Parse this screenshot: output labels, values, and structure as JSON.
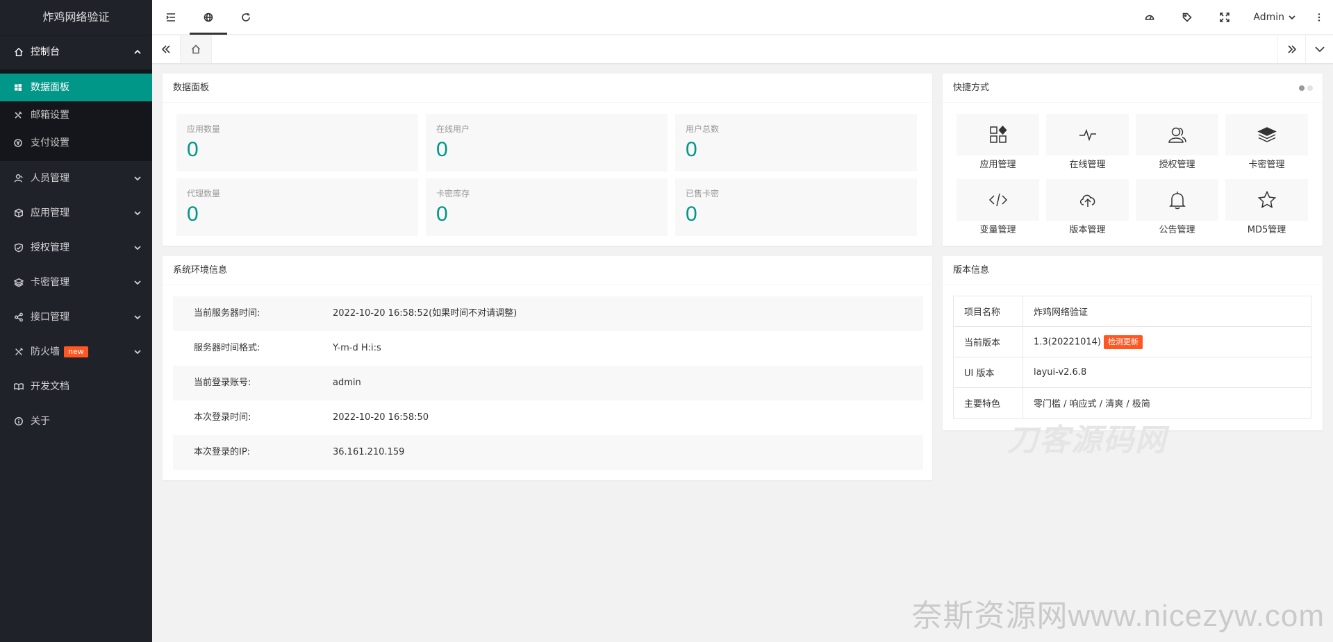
{
  "sidebar": {
    "logo": "炸鸡网络验证",
    "groups": [
      {
        "label": "控制台",
        "icon": "home-icon",
        "expanded": true,
        "children": [
          {
            "label": "数据面板",
            "icon": "windows-icon",
            "active": true
          },
          {
            "label": "邮箱设置",
            "icon": "tools-icon"
          },
          {
            "label": "支付设置",
            "icon": "yen-icon"
          }
        ]
      },
      {
        "label": "人员管理",
        "icon": "user-icon"
      },
      {
        "label": "应用管理",
        "icon": "cube-icon"
      },
      {
        "label": "授权管理",
        "icon": "shield-icon"
      },
      {
        "label": "卡密管理",
        "icon": "layers-icon"
      },
      {
        "label": "接口管理",
        "icon": "share-icon"
      },
      {
        "label": "防火墙",
        "icon": "tools-icon",
        "badge": "new"
      },
      {
        "label": "开发文档",
        "icon": "read-icon"
      },
      {
        "label": "关于",
        "icon": "info-icon"
      }
    ]
  },
  "header": {
    "user": "Admin"
  },
  "data_panel": {
    "title": "数据面板",
    "stats": [
      {
        "label": "应用数量",
        "value": "0"
      },
      {
        "label": "在线用户",
        "value": "0"
      },
      {
        "label": "用户总数",
        "value": "0"
      },
      {
        "label": "代理数量",
        "value": "0"
      },
      {
        "label": "卡密库存",
        "value": "0"
      },
      {
        "label": "已售卡密",
        "value": "0"
      }
    ]
  },
  "shortcuts": {
    "title": "快捷方式",
    "items": [
      {
        "label": "应用管理",
        "icon": "apps-icon"
      },
      {
        "label": "在线管理",
        "icon": "pulse-icon"
      },
      {
        "label": "授权管理",
        "icon": "users-icon"
      },
      {
        "label": "卡密管理",
        "icon": "layers-icon"
      },
      {
        "label": "变量管理",
        "icon": "code-icon"
      },
      {
        "label": "版本管理",
        "icon": "upload-cloud-icon"
      },
      {
        "label": "公告管理",
        "icon": "bell-icon"
      },
      {
        "label": "MD5管理",
        "icon": "star-icon"
      }
    ]
  },
  "env": {
    "title": "系统环境信息",
    "rows": [
      {
        "k": "当前服务器时间:",
        "v": "2022-10-20 16:58:52(如果时间不对请调整)"
      },
      {
        "k": "服务器时间格式:",
        "v": "Y-m-d H:i:s"
      },
      {
        "k": "当前登录账号:",
        "v": "admin"
      },
      {
        "k": "本次登录时间:",
        "v": "2022-10-20 16:58:50"
      },
      {
        "k": "本次登录的IP:",
        "v": "36.161.210.159"
      }
    ]
  },
  "version": {
    "title": "版本信息",
    "rows": [
      {
        "k": "项目名称",
        "v": "炸鸡网络验证"
      },
      {
        "k": "当前版本",
        "v": "1.3(20221014)",
        "button": "检测更新"
      },
      {
        "k": "UI 版本",
        "v": "layui-v2.6.8"
      },
      {
        "k": "主要特色",
        "v": "零门槛 / 响应式 / 清爽 / 极简"
      }
    ]
  },
  "watermarks": {
    "center": "刀客源码网",
    "bottom": "奈斯资源网www.nicezyw.com"
  },
  "colors": {
    "sidebar_bg": "#20222a",
    "active": "#009688",
    "badge": "#ff5722"
  }
}
